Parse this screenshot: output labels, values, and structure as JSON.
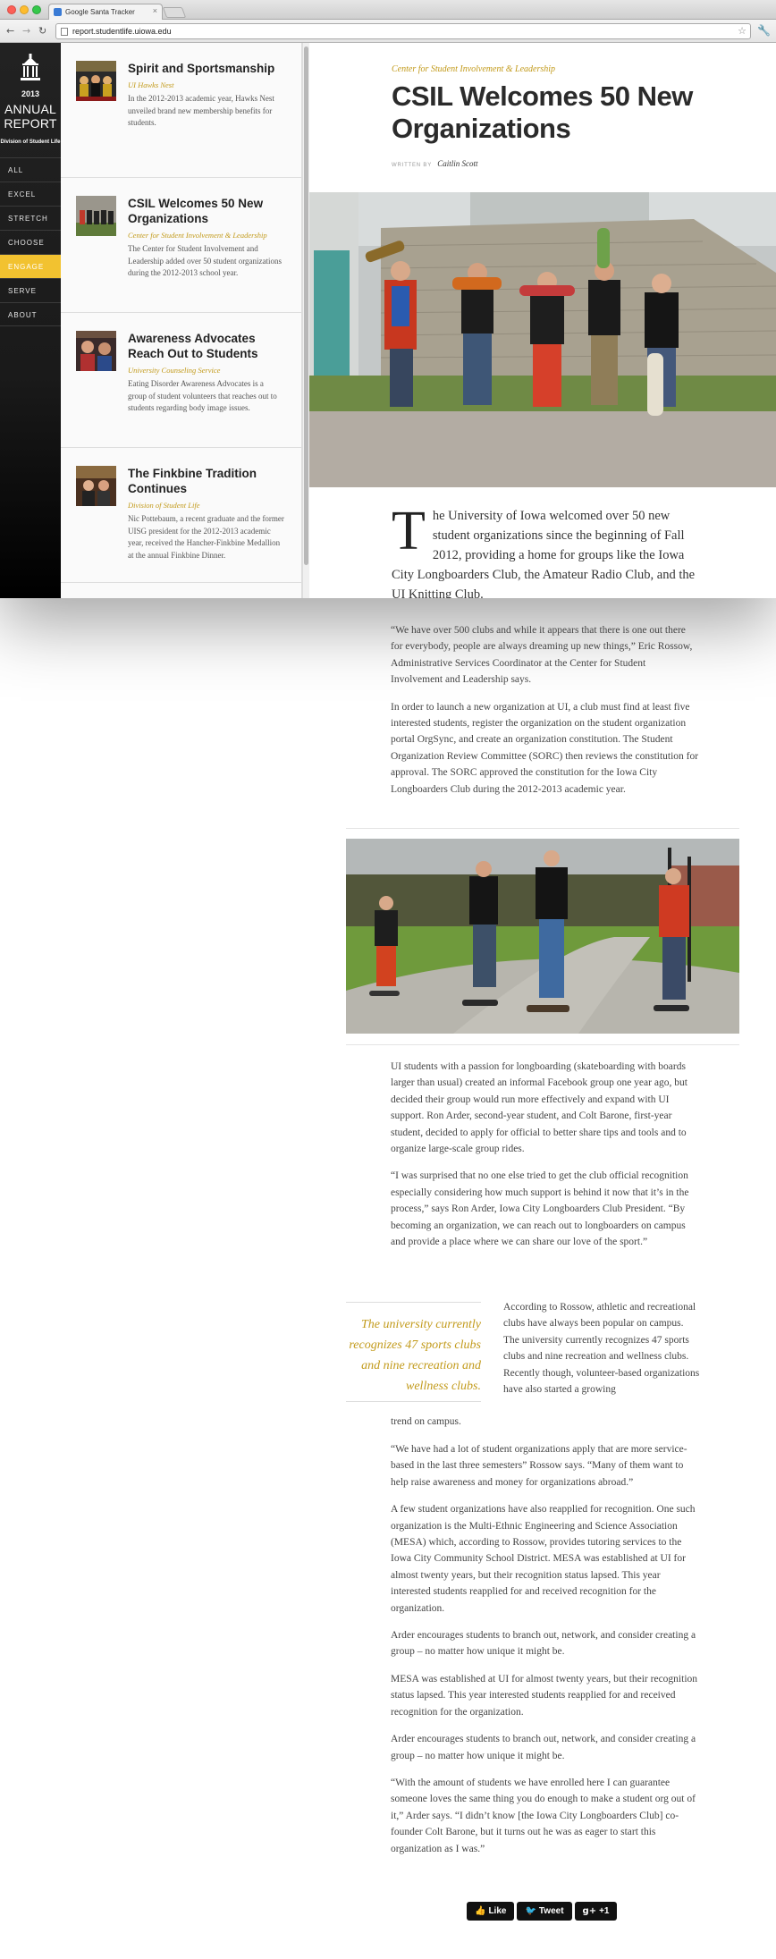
{
  "browser": {
    "tab_title": "Google Santa Tracker",
    "tab_close": "×",
    "url": "report.studentlife.uiowa.edu",
    "back_glyph": "←",
    "forward_glyph": "→",
    "reload_glyph": "↻",
    "star_glyph": "☆",
    "wrench_glyph": "🔧"
  },
  "sidebar": {
    "year": "2013",
    "title_line1": "ANNUAL",
    "title_line2": "REPORT",
    "subtitle": "Division of Student Life",
    "items": [
      {
        "label": "ALL"
      },
      {
        "label": "EXCEL"
      },
      {
        "label": "STRETCH"
      },
      {
        "label": "CHOOSE"
      },
      {
        "label": "ENGAGE",
        "active": true
      },
      {
        "label": "SERVE"
      },
      {
        "label": "ABOUT"
      }
    ],
    "active_color": "#f2c230"
  },
  "stories": [
    {
      "title": "Spirit and Sportsmanship",
      "dept": "UI Hawks Nest",
      "excerpt": "In the 2012-2013 academic year, Hawks Nest unveiled brand new membership benefits for students."
    },
    {
      "title": "CSIL Welcomes 50 New Organizations",
      "dept": "Center for Student Involvement & Leadership",
      "excerpt": "The Center for Student Involvement and Leadership added over 50 student organizations during the 2012-2013 school year."
    },
    {
      "title": "Awareness Advocates Reach Out to Students",
      "dept": "University Counseling Service",
      "excerpt": "Eating Disorder Awareness Advocates is a group of student volunteers that reaches out to students regarding body image issues."
    },
    {
      "title": "The Finkbine Tradition Continues",
      "dept": "Division of Student Life",
      "excerpt": "Nic Pottebaum, a recent graduate and the former UISG president for the 2012-2013 academic year, received the Hancher-Finkbine Medallion at the annual Finkbine Dinner."
    }
  ],
  "article": {
    "kicker": "Center for Student Involvement & Leadership",
    "title": "CSIL Welcomes 50 New Organizations",
    "byline_label": "WRITTEN BY",
    "author": "Caitlin Scott",
    "drop_cap": "T",
    "lead": "he University of Iowa welcomed over 50 new student organizations since the beginning of Fall 2012, providing a home for groups like the Iowa City Longboarders Club, the Amateur Radio Club, and the UI Knitting Club.",
    "p1": "“We have over 500 clubs and while it appears that there is one out there for everybody, people are always dreaming up new things,” Eric Rossow, Administrative Services Coordinator at the Center for Student Involvement and Leadership says.",
    "p2": "In order to launch a new organization at UI, a club must find at least five interested students, register the organization on the student organization portal OrgSync, and create an organization constitution. The Student Organization Review Committee (SORC) then reviews the constitution for approval. The SORC approved the constitution for the Iowa City Longboarders Club during the 2012-2013 academic year.",
    "p3": "UI students with a passion for longboarding (skateboarding with boards larger than usual) created an informal Facebook group one year ago, but decided their group would run more effectively and expand with UI support. Ron Arder, second-year student, and Colt Barone, first-year student, decided to apply for official to better share tips and tools and to organize large-scale group rides.",
    "p4": "“I was surprised that no one else tried to get the club official recognition especially considering how much support is behind it now that it’s in the process,” says Ron Arder, Iowa City Longboarders Club President. “By becoming an organization, we can reach out to longboarders on campus and provide a place where we can share our love of the sport.”",
    "pull_quote": "The university currently recognizes 47 sports clubs and nine recreation and wellness clubs.",
    "p5": "According to Rossow, athletic and recreational clubs have always been popular on campus. The university currently recognizes 47 sports clubs and nine recreation and wellness clubs. Recently though, volunteer-based organizations have also started a growing",
    "p5_tail": "trend on campus.",
    "p6": "“We have had a lot of student organizations apply that are more service-based in the last three semesters” Rossow says. “Many of them want to help raise awareness and money for organizations abroad.”",
    "p7": "A few student organizations have also reapplied for recognition. One such organization is the Multi-Ethnic Engineering and Science Association (MESA) which, according to Rossow, provides tutoring services to the Iowa City Community School District. MESA was established at UI for almost twenty years, but their recognition status lapsed. This year interested students reapplied for and received recognition for the organization.",
    "p8": "Arder encourages students to branch out, network, and consider creating a group – no matter how unique it might be.",
    "p9": "MESA was established at UI for almost twenty years, but their recognition status lapsed. This year interested students reapplied for and received recognition for the organization.",
    "p10": "Arder encourages students to branch out, network, and consider creating a group – no matter how unique it might be.",
    "p11": "“With the amount of students we have enrolled here I can guarantee someone loves the same thing you do enough to make a student org out of it,” Arder says. “I didn’t know [the Iowa City Longboarders Club] co-founder Colt Barone, but it turns out he was as eager to start this organization as I was.”"
  },
  "share": {
    "like_label": "Like",
    "like_icon": "👍",
    "tweet_label": "Tweet",
    "tweet_icon": "🐦",
    "gplus_label": "g+",
    "gplus_count": "+1"
  },
  "colors": {
    "accent": "#c29a1a",
    "nav_bg": "#1a1a1a",
    "active_nav": "#f2c230"
  }
}
